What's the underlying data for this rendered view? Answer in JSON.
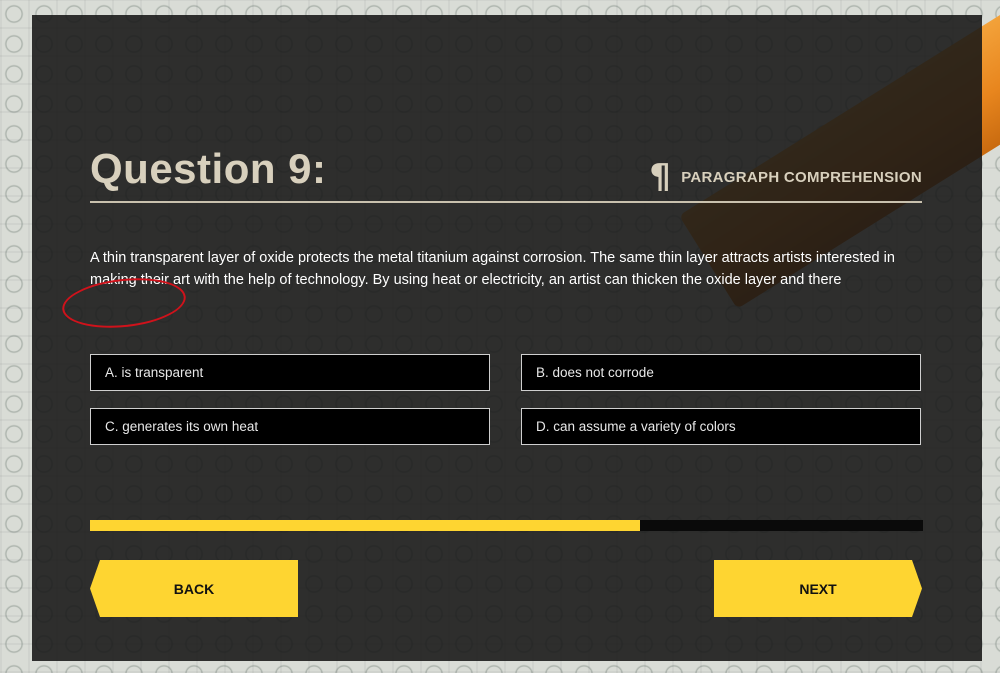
{
  "question": {
    "title": "Question 9:",
    "section": "PARAGRAPH COMPREHENSION",
    "section_icon": "pilcrow-icon",
    "passage": "A thin transparent layer of oxide protects the metal titanium against corrosion. The same thin layer attracts artists interested in making their art with the help of technology. By using heat or electricity, an artist can thicken the oxide layer and there"
  },
  "options": [
    {
      "label": "A. is transparent"
    },
    {
      "label": "B. does not corrode"
    },
    {
      "label": "C. generates its own heat"
    },
    {
      "label": "D. can assume a variety of colors"
    }
  ],
  "progress": {
    "fraction": 0.66
  },
  "nav": {
    "back_label": "BACK",
    "next_label": "NEXT"
  },
  "colors": {
    "accent": "#fed531",
    "annotation": "#d0121b",
    "panel": "#161616"
  }
}
